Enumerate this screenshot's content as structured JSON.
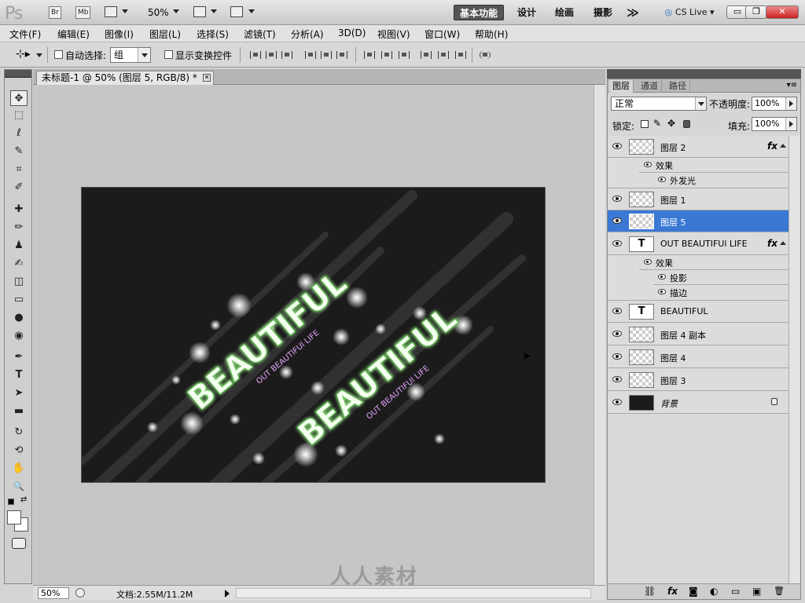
{
  "app": {
    "logo": "Ps",
    "bridge_label": "Br",
    "minibridge_label": "Mb",
    "zoom": "50%",
    "workspaces": [
      "基本功能",
      "设计",
      "绘画",
      "摄影"
    ],
    "more_glyph": "≫",
    "cs_live": "CS Live",
    "window_buttons": {
      "minimize": "▭",
      "restore": "❐",
      "close": "✕"
    }
  },
  "menu": [
    "文件(F)",
    "编辑(E)",
    "图像(I)",
    "图层(L)",
    "选择(S)",
    "滤镜(T)",
    "分析(A)",
    "3D(D)",
    "视图(V)",
    "窗口(W)",
    "帮助(H)"
  ],
  "options": {
    "auto_select_label": "自动选择:",
    "auto_select_value": "组",
    "show_transform_label": "显示变换控件"
  },
  "toolbox": {
    "tools": [
      "move-tool",
      "marquee-tool",
      "lasso-tool",
      "quick-select-tool",
      "crop-tool",
      "eyedropper-tool",
      "healing-tool",
      "brush-tool",
      "stamp-tool",
      "history-brush-tool",
      "eraser-tool",
      "gradient-tool",
      "blur-tool",
      "dodge-tool",
      "pen-tool",
      "type-tool",
      "path-select-tool",
      "shape-tool",
      "3d-rotate-tool",
      "3d-orbit-tool",
      "hand-tool",
      "zoom-tool"
    ],
    "glyphs": [
      "✥",
      "⬚",
      "ℓ",
      "✎",
      "⌗",
      "✐",
      "✚",
      "✏",
      "♟",
      "✍",
      "◫",
      "▭",
      "●",
      "◉",
      "✒",
      "T",
      "➤",
      "▬",
      "↻",
      "⟲",
      "✋",
      "🔍"
    ]
  },
  "document": {
    "tab_title": "未标题-1 @ 50% (图层 5, RGB/8) *",
    "close_glyph": "✕",
    "canvas_texts": {
      "big1": "BEAUTIFUL",
      "small1": "OUT BEAUTIFUl LIFE",
      "big2": "BEAUTIFUL",
      "small2": "OUT BEAUTIFUl LIFE"
    },
    "colors": {
      "canvas_bg": "#1b1b1b",
      "glow": "#7de06a",
      "subtitle": "#e6a6ff"
    }
  },
  "status": {
    "zoom": "50%",
    "doc_info": "文档:2.55M/11.2M"
  },
  "layers_panel": {
    "tabs": [
      "图层",
      "通道",
      "路径"
    ],
    "blend_mode": "正常",
    "opacity_label": "不透明度:",
    "opacity": "100%",
    "lock_label": "锁定:",
    "fill_label": "填充:",
    "fill": "100%",
    "layers": [
      {
        "name": "图层 2",
        "kind": "raster",
        "fx": "fx",
        "effects_label": "效果",
        "effects": [
          "外发光"
        ]
      },
      {
        "name": "图层 1",
        "kind": "raster"
      },
      {
        "name": "图层 5",
        "kind": "raster",
        "selected": true
      },
      {
        "name": "OUT BEAUTIFUl LIFE",
        "kind": "text",
        "fx": "fx",
        "effects_label": "效果",
        "effects": [
          "投影",
          "描边"
        ]
      },
      {
        "name": "BEAUTIFUL",
        "kind": "text"
      },
      {
        "name": "图层 4 副本",
        "kind": "raster"
      },
      {
        "name": "图层 4",
        "kind": "raster"
      },
      {
        "name": "图层 3",
        "kind": "raster"
      },
      {
        "name": "背景",
        "kind": "background",
        "locked": true
      }
    ],
    "footer_icons": [
      "link-icon",
      "fx-icon",
      "mask-icon",
      "adjustment-icon",
      "group-icon",
      "new-layer-icon",
      "delete-icon"
    ],
    "footer_glyphs": [
      "⛓",
      "fx",
      "◙",
      "◐",
      "▭",
      "▣",
      "🗑"
    ]
  },
  "watermark": "人人素材"
}
